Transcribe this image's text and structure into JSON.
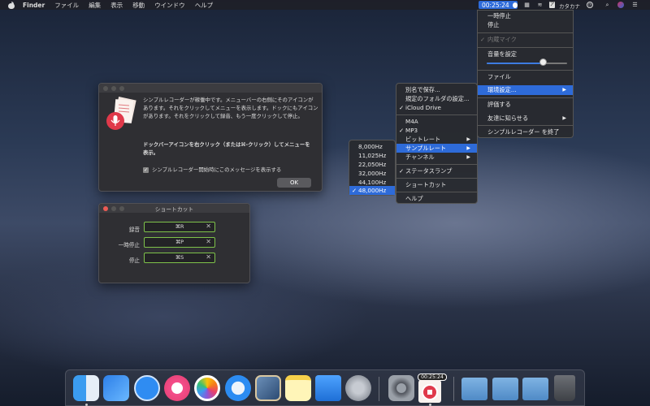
{
  "menubar": {
    "app": "Finder",
    "items": [
      "ファイル",
      "編集",
      "表示",
      "移動",
      "ウインドウ",
      "ヘルプ"
    ],
    "timer": "00:25:24",
    "input_mode": "カタカナ"
  },
  "main_menu": {
    "pause": "一時停止",
    "stop": "停止",
    "mic": "内蔵マイク",
    "volume": "音量を設定",
    "volume_level": 0.7,
    "file": "ファイル",
    "prefs": "環境設定...",
    "rate": "評価する",
    "tell": "友達に知らせる",
    "quit": "シンプルレコーダー を終了"
  },
  "prefs_menu": {
    "save_as": "別名で保存...",
    "default_folder": "規定のフォルダの設定...",
    "icloud": "iCloud Drive",
    "m4a": "M4A",
    "mp3": "MP3",
    "bitrate": "ビットレート",
    "samplerate": "サンプルレート",
    "channel": "チャンネル",
    "status_lamp": "ステータスランプ",
    "shortcut": "ショートカット",
    "help": "ヘルプ"
  },
  "rates": [
    "8,000Hz",
    "11,025Hz",
    "22,050Hz",
    "32,000Hz",
    "44,100Hz",
    "48,000Hz"
  ],
  "welcome": {
    "line1": "シンプルレコーダーが稼働中です。メニューバーの右側にそのアイコンが",
    "line2": "あります。それをクリックしてメニューを表示します。ドックにもアイコン",
    "line3": "があります。それをクリックして録音、もう一度クリックして停止。",
    "line4": "ドックバーアイコンを右クリック（または⌘-クリック）してメニューを",
    "line5": "表示。",
    "checkbox": "シンプルレコーダー開始時にこのメッセージを表示する",
    "ok": "OK"
  },
  "shortcut": {
    "title": "ショートカット",
    "rec_label": "録音",
    "rec_key": "⌘R",
    "pause_label": "一時停止",
    "pause_key": "⌘P",
    "stop_label": "停止",
    "stop_key": "⌘S"
  },
  "dock": {
    "timer": "00:25:24"
  }
}
